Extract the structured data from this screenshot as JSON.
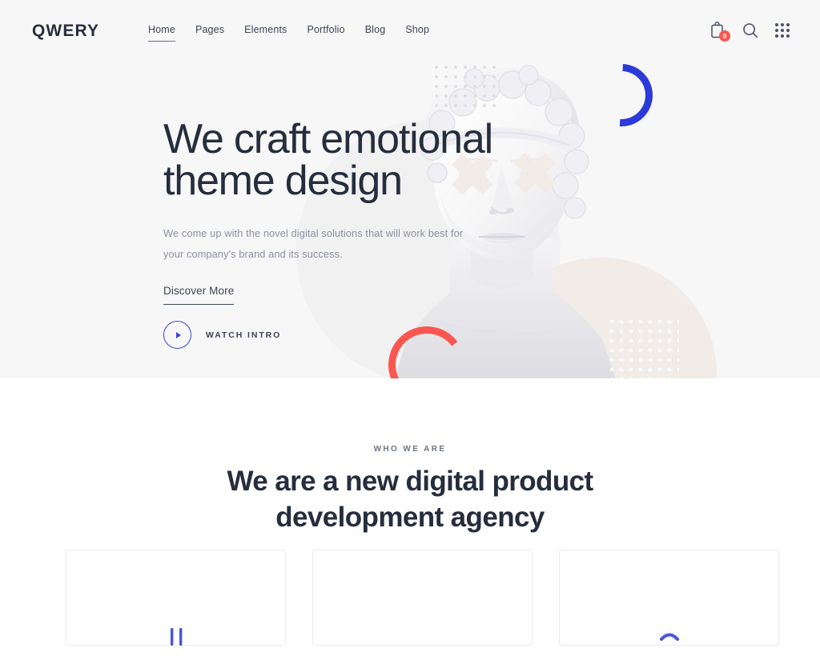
{
  "header": {
    "logo": "QWERY",
    "nav": [
      {
        "label": "Home",
        "active": true
      },
      {
        "label": "Pages",
        "active": false
      },
      {
        "label": "Elements",
        "active": false
      },
      {
        "label": "Portfolio",
        "active": false
      },
      {
        "label": "Blog",
        "active": false
      },
      {
        "label": "Shop",
        "active": false
      }
    ],
    "icons": {
      "cart": "shopping-bag-icon",
      "cart_badge": "0",
      "search": "search-icon",
      "grid": "grid-menu-icon"
    }
  },
  "hero": {
    "title_line1": "We craft emotional",
    "title_line2": "theme design",
    "description": "We come up with the novel digital solutions that will work best for your company's brand and its success.",
    "discover_label": "Discover More",
    "watch_label": "WATCH INTRO",
    "play_icon": "play-icon",
    "decorations": {
      "blue_arc": "#2b3ad9",
      "red_arc": "#f9564f",
      "beige_circle": "#f2ece8",
      "dot_grid_gray": "#e0e0e3",
      "dot_grid_white": "#ffffff",
      "statue": "marble-bust-illustration",
      "eye_cross": "x-mark"
    },
    "background": "#f7f7f8"
  },
  "about": {
    "eyebrow": "WHO WE ARE",
    "title_line1": "We are a new digital product",
    "title_line2": "development agency",
    "cards": [
      {
        "icon": "pause-bars-icon",
        "accent": "#4a55d6"
      },
      {
        "icon": "blank-icon",
        "accent": "#4a55d6"
      },
      {
        "icon": "arc-icon",
        "accent": "#4a55d6"
      }
    ]
  },
  "theme": {
    "accent_blue": "#2b3ad9",
    "accent_red": "#f9564f",
    "text_dark": "#262d3d",
    "text_muted": "#8b90a0",
    "bg_light": "#f7f7f8",
    "bg_white": "#ffffff"
  }
}
